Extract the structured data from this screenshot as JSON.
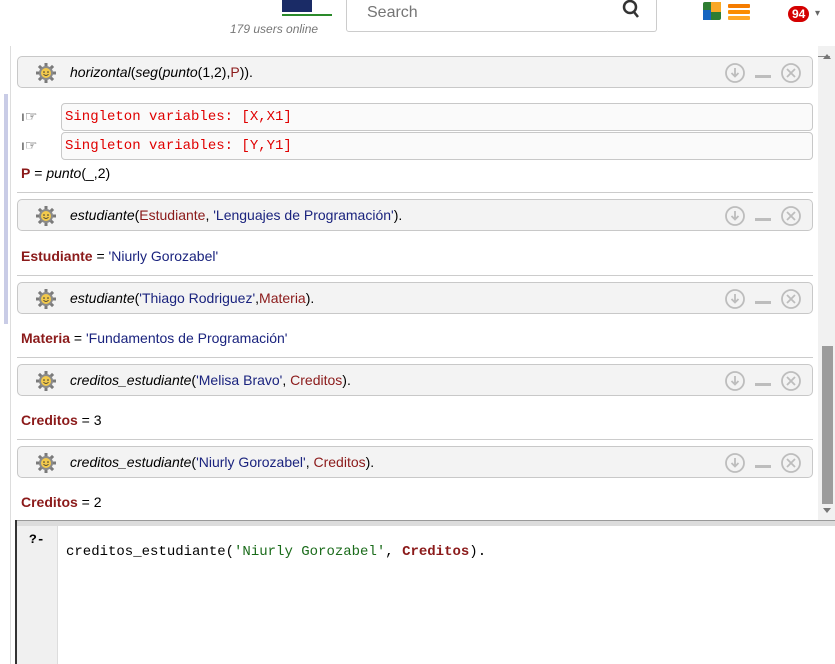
{
  "header": {
    "users_online": "179 users online",
    "search_placeholder": "Search",
    "notification_count": "94"
  },
  "answers": [
    {
      "query_parts": [
        {
          "t": "horizontal",
          "c": "fn"
        },
        {
          "t": "(",
          "c": "p"
        },
        {
          "t": "seg",
          "c": "fn"
        },
        {
          "t": "(",
          "c": "p"
        },
        {
          "t": "punto",
          "c": "fn"
        },
        {
          "t": "(1,2),",
          "c": "p"
        },
        {
          "t": "P",
          "c": "var"
        },
        {
          "t": ")).",
          "c": "p"
        }
      ],
      "warnings": [
        "Singleton variables: [X,X1]",
        "Singleton variables: [Y,Y1]"
      ],
      "result": {
        "var": "P",
        "eq": " = ",
        "value_parts": [
          {
            "t": "punto",
            "c": "fn"
          },
          {
            "t": "(_,2)",
            "c": "num"
          }
        ]
      }
    },
    {
      "query_parts": [
        {
          "t": "estudiante",
          "c": "fn"
        },
        {
          "t": "(",
          "c": "p"
        },
        {
          "t": "Estudiante",
          "c": "var"
        },
        {
          "t": ", ",
          "c": "p"
        },
        {
          "t": "'Lenguajes de Programación'",
          "c": "str"
        },
        {
          "t": ").",
          "c": "p"
        }
      ],
      "result": {
        "var": "Estudiante",
        "eq": " = ",
        "value_parts": [
          {
            "t": "'Niurly Gorozabel'",
            "c": "str"
          }
        ]
      }
    },
    {
      "query_parts": [
        {
          "t": "estudiante",
          "c": "fn"
        },
        {
          "t": "(",
          "c": "p"
        },
        {
          "t": "'Thiago Rodriguez'",
          "c": "str"
        },
        {
          "t": ",",
          "c": "p"
        },
        {
          "t": "Materia",
          "c": "var"
        },
        {
          "t": ").",
          "c": "p"
        }
      ],
      "result": {
        "var": "Materia",
        "eq": " = ",
        "value_parts": [
          {
            "t": "'Fundamentos de Programación'",
            "c": "str"
          }
        ]
      }
    },
    {
      "query_parts": [
        {
          "t": "creditos_estudiante",
          "c": "fn"
        },
        {
          "t": "(",
          "c": "p"
        },
        {
          "t": "'Melisa Bravo'",
          "c": "str"
        },
        {
          "t": ", ",
          "c": "p"
        },
        {
          "t": "Creditos",
          "c": "var"
        },
        {
          "t": ").",
          "c": "p"
        }
      ],
      "result": {
        "var": "Creditos",
        "eq": " = ",
        "value_parts": [
          {
            "t": "3",
            "c": "num"
          }
        ]
      }
    },
    {
      "query_parts": [
        {
          "t": "creditos_estudiante",
          "c": "fn"
        },
        {
          "t": "(",
          "c": "p"
        },
        {
          "t": "'Niurly Gorozabel'",
          "c": "str"
        },
        {
          "t": ", ",
          "c": "p"
        },
        {
          "t": "Creditos",
          "c": "var"
        },
        {
          "t": ").",
          "c": "p"
        }
      ],
      "result": {
        "var": "Creditos",
        "eq": " = ",
        "value_parts": [
          {
            "t": "2",
            "c": "num"
          }
        ]
      }
    }
  ],
  "editor": {
    "prompt": "?-",
    "code_parts": [
      {
        "t": "creditos_estudiante(",
        "c": "fn"
      },
      {
        "t": "'Niurly Gorozabel'",
        "c": "str"
      },
      {
        "t": ", ",
        "c": "fn"
      },
      {
        "t": "Creditos",
        "c": "var"
      },
      {
        "t": ").",
        "c": "fn"
      }
    ]
  },
  "colors": {
    "variable": "#8b1a1a",
    "string": "#1a237e",
    "warning": "#e00000"
  }
}
